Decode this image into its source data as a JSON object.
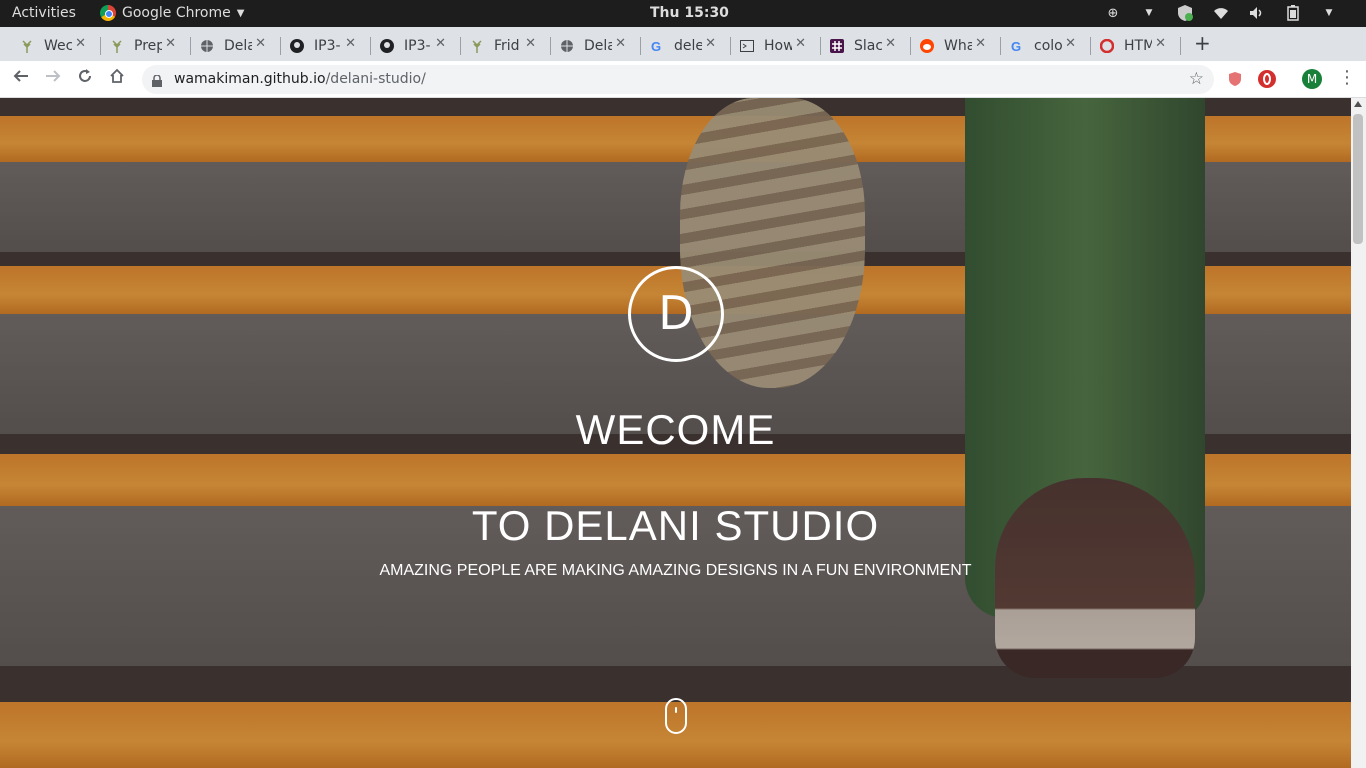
{
  "system_bar": {
    "activities": "Activities",
    "app_name": "Google Chrome",
    "clock": "Thu 15:30"
  },
  "tabs": [
    {
      "label": "Wec",
      "icon": "leaf-icon"
    },
    {
      "label": "Prep",
      "icon": "leaf-icon"
    },
    {
      "label": "Dela",
      "icon": "globe-icon"
    },
    {
      "label": "IP3-",
      "icon": "github-icon"
    },
    {
      "label": "IP3-",
      "icon": "github-icon"
    },
    {
      "label": "Frid",
      "icon": "leaf-icon"
    },
    {
      "label": "Dela",
      "icon": "globe-icon"
    },
    {
      "label": "dele",
      "icon": "google-icon"
    },
    {
      "label": "How",
      "icon": "terminal-icon"
    },
    {
      "label": "Slac",
      "icon": "slack-icon"
    },
    {
      "label": "Wha",
      "icon": "reddit-icon"
    },
    {
      "label": "colo",
      "icon": "google-icon"
    },
    {
      "label": "HTM",
      "icon": "opera-icon"
    }
  ],
  "address_bar": {
    "host": "wamakiman.github.io",
    "path": "/delani-studio/"
  },
  "profile": {
    "initial": "M"
  },
  "hero": {
    "logo_letter": "D",
    "welcome": "WECOME",
    "studio": "TO DELANI STUDIO",
    "tagline": "AMAZING PEOPLE ARE MAKING AMAZING DESIGNS IN A FUN ENVIRONMENT"
  },
  "colors": {
    "accent_orange": "#f4a53a",
    "topbar": "#1d1d1d",
    "tabstrip": "#dee1e6"
  }
}
